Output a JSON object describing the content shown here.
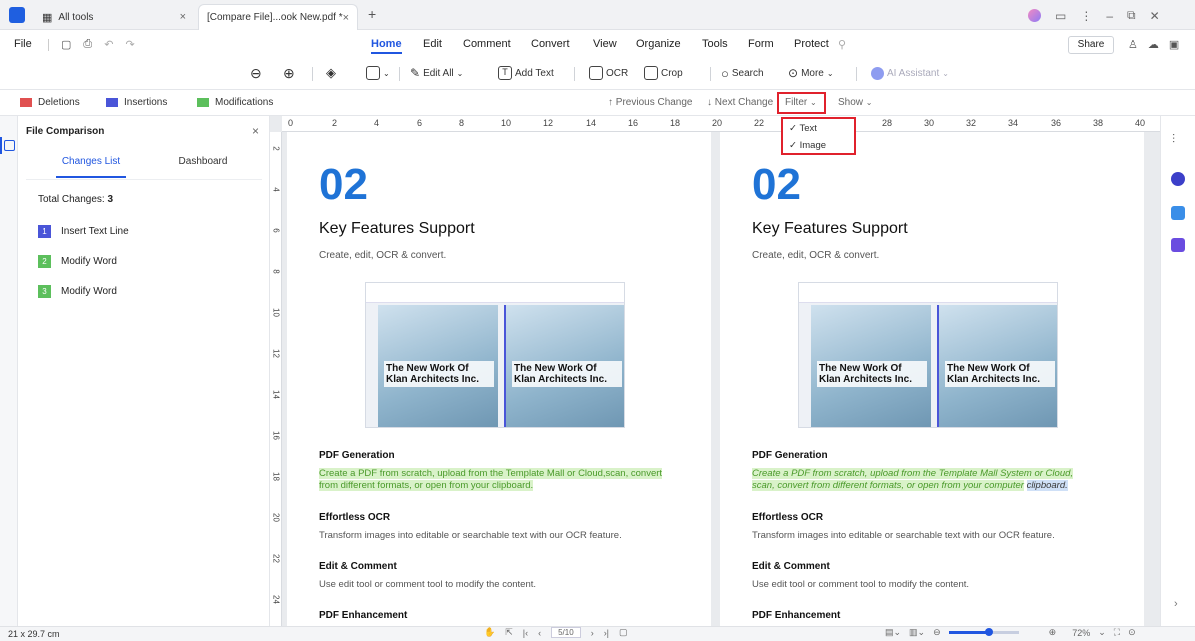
{
  "tabs": {
    "home": "All tools",
    "active": "[Compare File]...ook New.pdf *"
  },
  "colors": {
    "accent": "#2056e0",
    "deletions": "#e05050",
    "insertions": "#4a55d8",
    "modifications": "#5cbf5c",
    "highlight": "#e0212c"
  },
  "menu": {
    "file": "File",
    "items": [
      "Home",
      "Edit",
      "Comment",
      "Convert",
      "View",
      "Organize",
      "Tools",
      "Form",
      "Protect"
    ],
    "share": "Share"
  },
  "toolbar": {
    "edit_all": "Edit All",
    "add_text": "Add Text",
    "ocr": "OCR",
    "crop": "Crop",
    "search": "Search",
    "more": "More",
    "ai": "AI Assistant"
  },
  "compare": {
    "deletions": "Deletions",
    "insertions": "Insertions",
    "modifications": "Modifications",
    "prev": "Previous Change",
    "next": "Next Change",
    "filter": "Filter",
    "show": "Show"
  },
  "filter_menu": {
    "text": "Text",
    "image": "Image"
  },
  "panel": {
    "title": "File Comparison",
    "tab_changes": "Changes List",
    "tab_dashboard": "Dashboard",
    "total_label": "Total Changes:",
    "total_value": "3",
    "changes": [
      {
        "n": "1",
        "label": "Insert Text Line"
      },
      {
        "n": "2",
        "label": "Modify Word"
      },
      {
        "n": "3",
        "label": "Modify Word"
      }
    ]
  },
  "ruler": [
    "0",
    "2",
    "4",
    "6",
    "8",
    "10",
    "12",
    "14",
    "16",
    "18",
    "20",
    "22",
    "24",
    "28",
    "30",
    "32",
    "34",
    "36",
    "38",
    "40",
    "42"
  ],
  "vruler": [
    "2",
    "4",
    "6",
    "8",
    "10",
    "12",
    "14",
    "16",
    "18",
    "20",
    "22",
    "24"
  ],
  "doc_left": {
    "num": "02",
    "title": "Key Features Support",
    "subtitle": "Create, edit, OCR & convert.",
    "shot_a": "The New Work Of Klan Architects Inc.",
    "shot_b": "The New Work Of Klan Architects Inc.",
    "s1_title": "PDF Generation",
    "s1_text": "Create a PDF from scratch, upload from the Template Mall or Cloud,scan, convert from different formats, or open from your clipboard.",
    "s2_title": "Effortless OCR",
    "s2_text": "Transform images into editable or searchable text with our OCR feature.",
    "s3_title": "Edit & Comment",
    "s3_text": "Use edit tool or comment tool to modify the content.",
    "s4_title": "PDF Enhancement"
  },
  "doc_right": {
    "num": "02",
    "title": "Key Features Support",
    "subtitle": "Create, edit, OCR & convert.",
    "shot_a": "The New Work Of Klan Architects Inc.",
    "shot_b": "The New Work Of Klan Architects Inc.",
    "s1_title": "PDF Generation",
    "s1_text_a": "Create a PDF from scratch, upload from the Template Mall System or Cloud, scan, convert from different formats, or open from your computer",
    "s1_text_b": "clipboard.",
    "s2_title": "Effortless OCR",
    "s2_text": "Transform images into editable or searchable text with our OCR feature.",
    "s3_title": "Edit & Comment",
    "s3_text": "Use edit tool or comment tool to modify the content.",
    "s4_title": "PDF Enhancement"
  },
  "status": {
    "size": "21 x 29.7 cm",
    "page": "5/10",
    "zoom": "72%"
  }
}
